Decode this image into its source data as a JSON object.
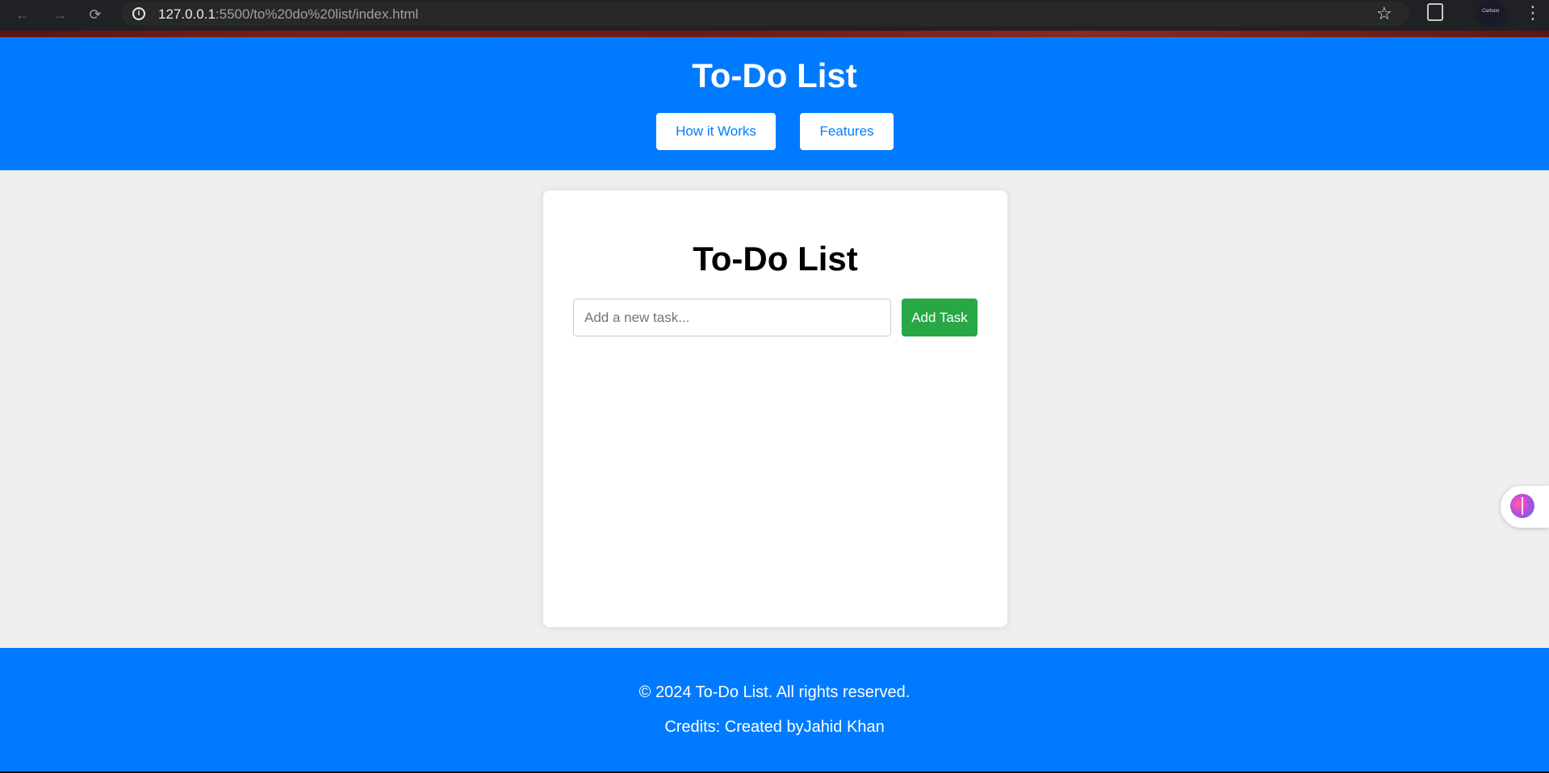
{
  "browser": {
    "url_host": "127.0.0.1",
    "url_rest": ":5500/to%20do%20list/index.html",
    "back_icon": "←",
    "forward_icon": "→",
    "reload_icon": "⟳",
    "info_icon": "i",
    "star_icon": "☆",
    "menu_icon": "⋮",
    "profile_label": "Cartoon"
  },
  "header": {
    "title": "To-Do List",
    "buttons": [
      {
        "label": "How it Works"
      },
      {
        "label": "Features"
      }
    ]
  },
  "main": {
    "card_title": "To-Do List",
    "task_input": {
      "value": "",
      "placeholder": "Add a new task..."
    },
    "add_button_label": "Add Task",
    "tasks": []
  },
  "footer": {
    "copyright": "© 2024 To-Do List. All rights reserved.",
    "credits": "Credits: Created byJahid Khan"
  },
  "colors": {
    "brand_blue": "#007bff",
    "add_green": "#28a745",
    "page_bg": "#efefef"
  },
  "widget": {
    "icon": "brain-icon"
  }
}
